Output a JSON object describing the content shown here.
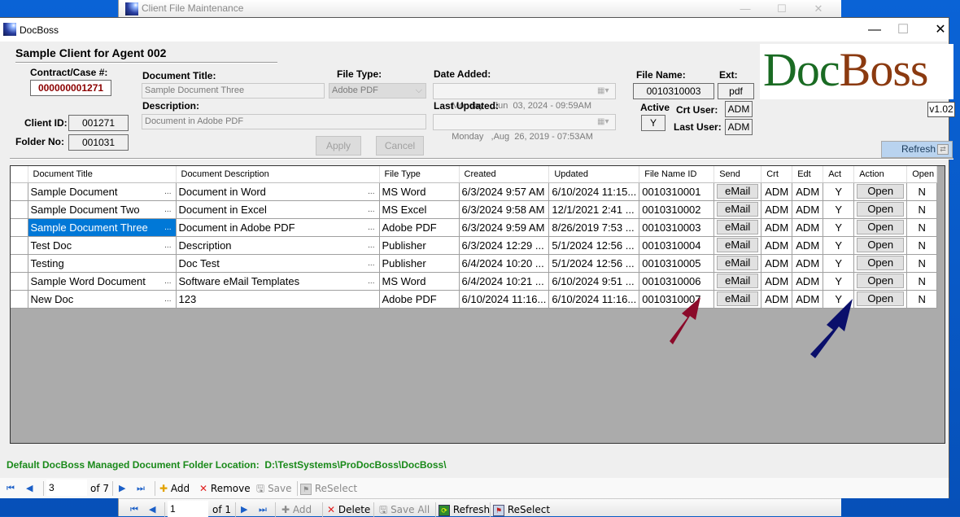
{
  "back_window": {
    "title": "Client File Maintenance",
    "toolbar": {
      "position": "1",
      "of_label": "of 1",
      "add_label": "Add",
      "delete_label": "Delete",
      "save_all_label": "Save All",
      "refresh_label": "Refresh",
      "reselect_label": "ReSelect"
    }
  },
  "window": {
    "title": "DocBoss",
    "minimize": "—",
    "maximize": "☐",
    "close": "✕"
  },
  "header": {
    "client_title": "Sample Client for Agent 002",
    "contract_label": "Contract/Case #:",
    "contract_value": "000000001271",
    "client_id_label": "Client ID:",
    "client_id_value": "001271",
    "folder_no_label": "Folder No:",
    "folder_no_value": "001031",
    "doc_title_label": "Document Title:",
    "doc_title_value": "Sample Document Three",
    "file_type_label": "File Type:",
    "file_type_value": "Adobe PDF",
    "description_label": "Description:",
    "description_value": "Document in Adobe PDF",
    "date_added_label": "Date Added:",
    "date_added_value": "Monday   ,Jun  03, 2024 - 09:59AM",
    "last_updated_label": "Last Updated:",
    "last_updated_value": "Monday   ,Aug  26, 2019 - 07:53AM",
    "file_name_label": "File Name:",
    "file_name_value": "0010310003",
    "ext_label": "Ext:",
    "ext_value": "pdf",
    "active_label": "Active",
    "active_value": "Y",
    "crt_user_label": "Crt User:",
    "crt_user_value": "ADM",
    "last_user_label": "Last User:",
    "last_user_value": "ADM",
    "apply_label": "Apply",
    "cancel_label": "Cancel"
  },
  "logo": {
    "part1": "Doc",
    "part2": "Boss",
    "color1": "#1a6b23",
    "color2": "#8b3a10"
  },
  "version": "v1.02",
  "refresh_label": "Refresh",
  "grid": {
    "columns": [
      "Document Title",
      "Document Description",
      "File Type",
      "Created",
      "Updated",
      "File Name ID",
      "Send",
      "Crt",
      "Edt",
      "Act",
      "Action",
      "Open"
    ],
    "selected_row": 2,
    "rows": [
      {
        "title": "Sample Document",
        "desc": "Document in Word",
        "type": "MS Word",
        "created": "6/3/2024 9:57 AM",
        "updated": "6/10/2024 11:15...",
        "file_id": "0010310001",
        "send": "eMail",
        "crt": "ADM",
        "edt": "ADM",
        "act": "Y",
        "action": "Open",
        "open": "N"
      },
      {
        "title": "Sample Document Two",
        "desc": "Document in Excel",
        "type": "MS Excel",
        "created": "6/3/2024 9:58 AM",
        "updated": "12/1/2021 2:41 ...",
        "file_id": "0010310002",
        "send": "eMail",
        "crt": "ADM",
        "edt": "ADM",
        "act": "Y",
        "action": "Open",
        "open": "N"
      },
      {
        "title": "Sample Document Three",
        "desc": "Document in Adobe PDF",
        "type": "Adobe PDF",
        "created": "6/3/2024 9:59 AM",
        "updated": "8/26/2019 7:53 ...",
        "file_id": "0010310003",
        "send": "eMail",
        "crt": "ADM",
        "edt": "ADM",
        "act": "Y",
        "action": "Open",
        "open": "N"
      },
      {
        "title": "Test Doc",
        "desc": "Description",
        "type": "Publisher",
        "created": "6/3/2024 12:29 ...",
        "updated": "5/1/2024 12:56 ...",
        "file_id": "0010310004",
        "send": "eMail",
        "crt": "ADM",
        "edt": "ADM",
        "act": "Y",
        "action": "Open",
        "open": "N"
      },
      {
        "title": "Testing",
        "desc": "Doc Test",
        "type": "Publisher",
        "created": "6/4/2024 10:20 ...",
        "updated": "5/1/2024 12:56 ...",
        "file_id": "0010310005",
        "send": "eMail",
        "crt": "ADM",
        "edt": "ADM",
        "act": "Y",
        "action": "Open",
        "open": "N"
      },
      {
        "title": "Sample Word Document",
        "desc": "Software eMail Templates",
        "type": "MS Word",
        "created": "6/4/2024 10:21 ...",
        "updated": "6/10/2024 9:51 ...",
        "file_id": "0010310006",
        "send": "eMail",
        "crt": "ADM",
        "edt": "ADM",
        "act": "Y",
        "action": "Open",
        "open": "N"
      },
      {
        "title": "New Doc",
        "desc": "123",
        "type": "Adobe PDF",
        "created": "6/10/2024 11:16...",
        "updated": "6/10/2024 11:16...",
        "file_id": "0010310007",
        "send": "eMail",
        "crt": "ADM",
        "edt": "ADM",
        "act": "Y",
        "action": "Open",
        "open": "N"
      }
    ],
    "title_ellipsis": [
      true,
      true,
      true,
      true,
      false,
      true,
      true
    ],
    "desc_ellipsis": [
      true,
      true,
      true,
      true,
      true,
      true,
      false
    ]
  },
  "annotations": {
    "arrow1_color": "#8b0a2a",
    "arrow2_color": "#0a0f6b"
  },
  "footer": {
    "folder_label": "Default DocBoss Managed Document Folder Location:",
    "folder_path": "D:\\TestSystems\\ProDocBoss\\DocBoss\\"
  },
  "toolbar": {
    "position": "3",
    "of_label": "of 7",
    "add_label": "Add",
    "remove_label": "Remove",
    "save_label": "Save",
    "reselect_label": "ReSelect"
  }
}
